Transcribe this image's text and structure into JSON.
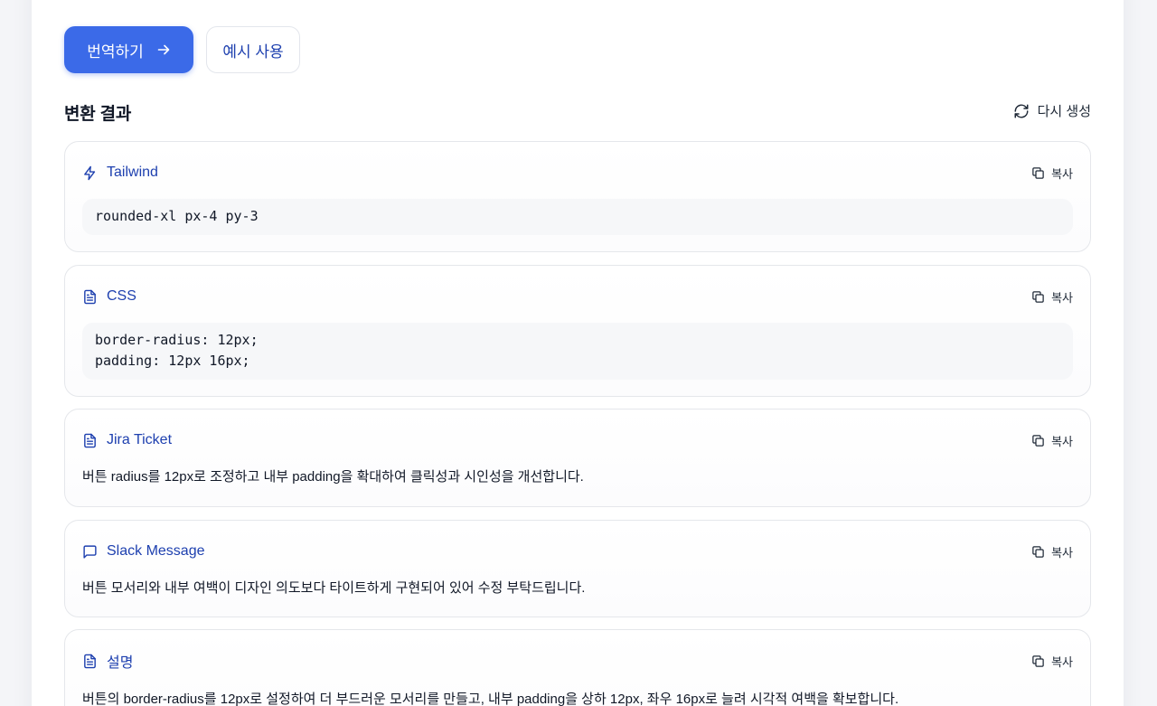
{
  "actions": {
    "translate_label": "번역하기",
    "example_label": "예시 사용"
  },
  "results": {
    "title": "변환 결과",
    "regenerate_label": "다시 생성"
  },
  "cards": [
    {
      "title": "Tailwind",
      "icon": "lightning-icon",
      "copy_label": "복사",
      "code": "rounded-xl px-4 py-3"
    },
    {
      "title": "CSS",
      "icon": "document-icon",
      "copy_label": "복사",
      "code": "border-radius: 12px;\npadding: 12px 16px;"
    },
    {
      "title": "Jira Ticket",
      "icon": "document-icon",
      "copy_label": "복사",
      "text": "버튼 radius를 12px로 조정하고 내부 padding을 확대하여 클릭성과 시인성을 개선합니다."
    },
    {
      "title": "Slack Message",
      "icon": "message-icon",
      "copy_label": "복사",
      "text": "버튼 모서리와 내부 여백이 디자인 의도보다 타이트하게 구현되어 있어 수정 부탁드립니다."
    },
    {
      "title": "설명",
      "icon": "document-icon",
      "copy_label": "복사",
      "text": "버튼의 border-radius를 12px로 설정하여 더 부드러운 모서리를 만들고, 내부 padding을 상하 12px, 좌우 16px로 늘려 시각적 여백을 확보합니다."
    }
  ],
  "colors": {
    "accent": "#3b6ae8",
    "title_blue": "#1e40af",
    "border": "#e5e7eb",
    "code_bg": "#f6f7f9"
  }
}
